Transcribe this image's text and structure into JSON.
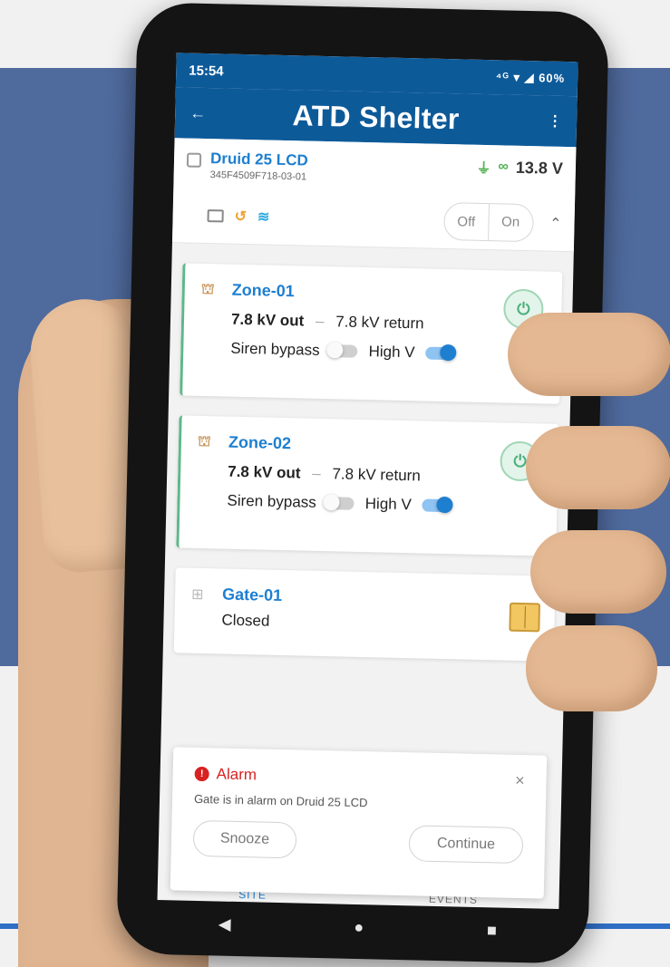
{
  "status_bar": {
    "time": "15:54",
    "icons": "⁴ᴳ ▾ ◢ 60%"
  },
  "app": {
    "title": "ATD Shelter",
    "back_icon": "←",
    "more_icon": "⋮"
  },
  "device": {
    "name": "Druid 25 LCD",
    "serial": "345F4509F718-03-01",
    "voltage": "13.8 V",
    "off_label": "Off",
    "on_label": "On"
  },
  "zones": [
    {
      "name": "Zone-01",
      "out": "7.8 kV out",
      "dash": "–",
      "return": "7.8 kV return",
      "siren_label": "Siren bypass",
      "siren_on": false,
      "highv_label": "High V",
      "highv_on": true
    },
    {
      "name": "Zone-02",
      "out": "7.8 kV out",
      "dash": "–",
      "return": "7.8 kV return",
      "siren_label": "Siren bypass",
      "siren_on": false,
      "highv_label": "High V",
      "highv_on": true
    }
  ],
  "gate": {
    "name": "Gate-01",
    "status": "Closed"
  },
  "alarm": {
    "title": "Alarm",
    "message": "Gate is in alarm on Druid 25 LCD",
    "snooze_label": "Snooze",
    "continue_label": "Continue",
    "close_icon": "×"
  },
  "tabs": {
    "site": "SITE",
    "events": "EVENTS"
  },
  "colors": {
    "app_bar": "#0d5a99",
    "accent_blue": "#1e7fd0",
    "zone_green": "#5cb88a",
    "alarm_red": "#d82121",
    "background_panel": "#4f6a9d"
  },
  "nav": {
    "back": "◀",
    "home": "●",
    "recents": "■"
  }
}
